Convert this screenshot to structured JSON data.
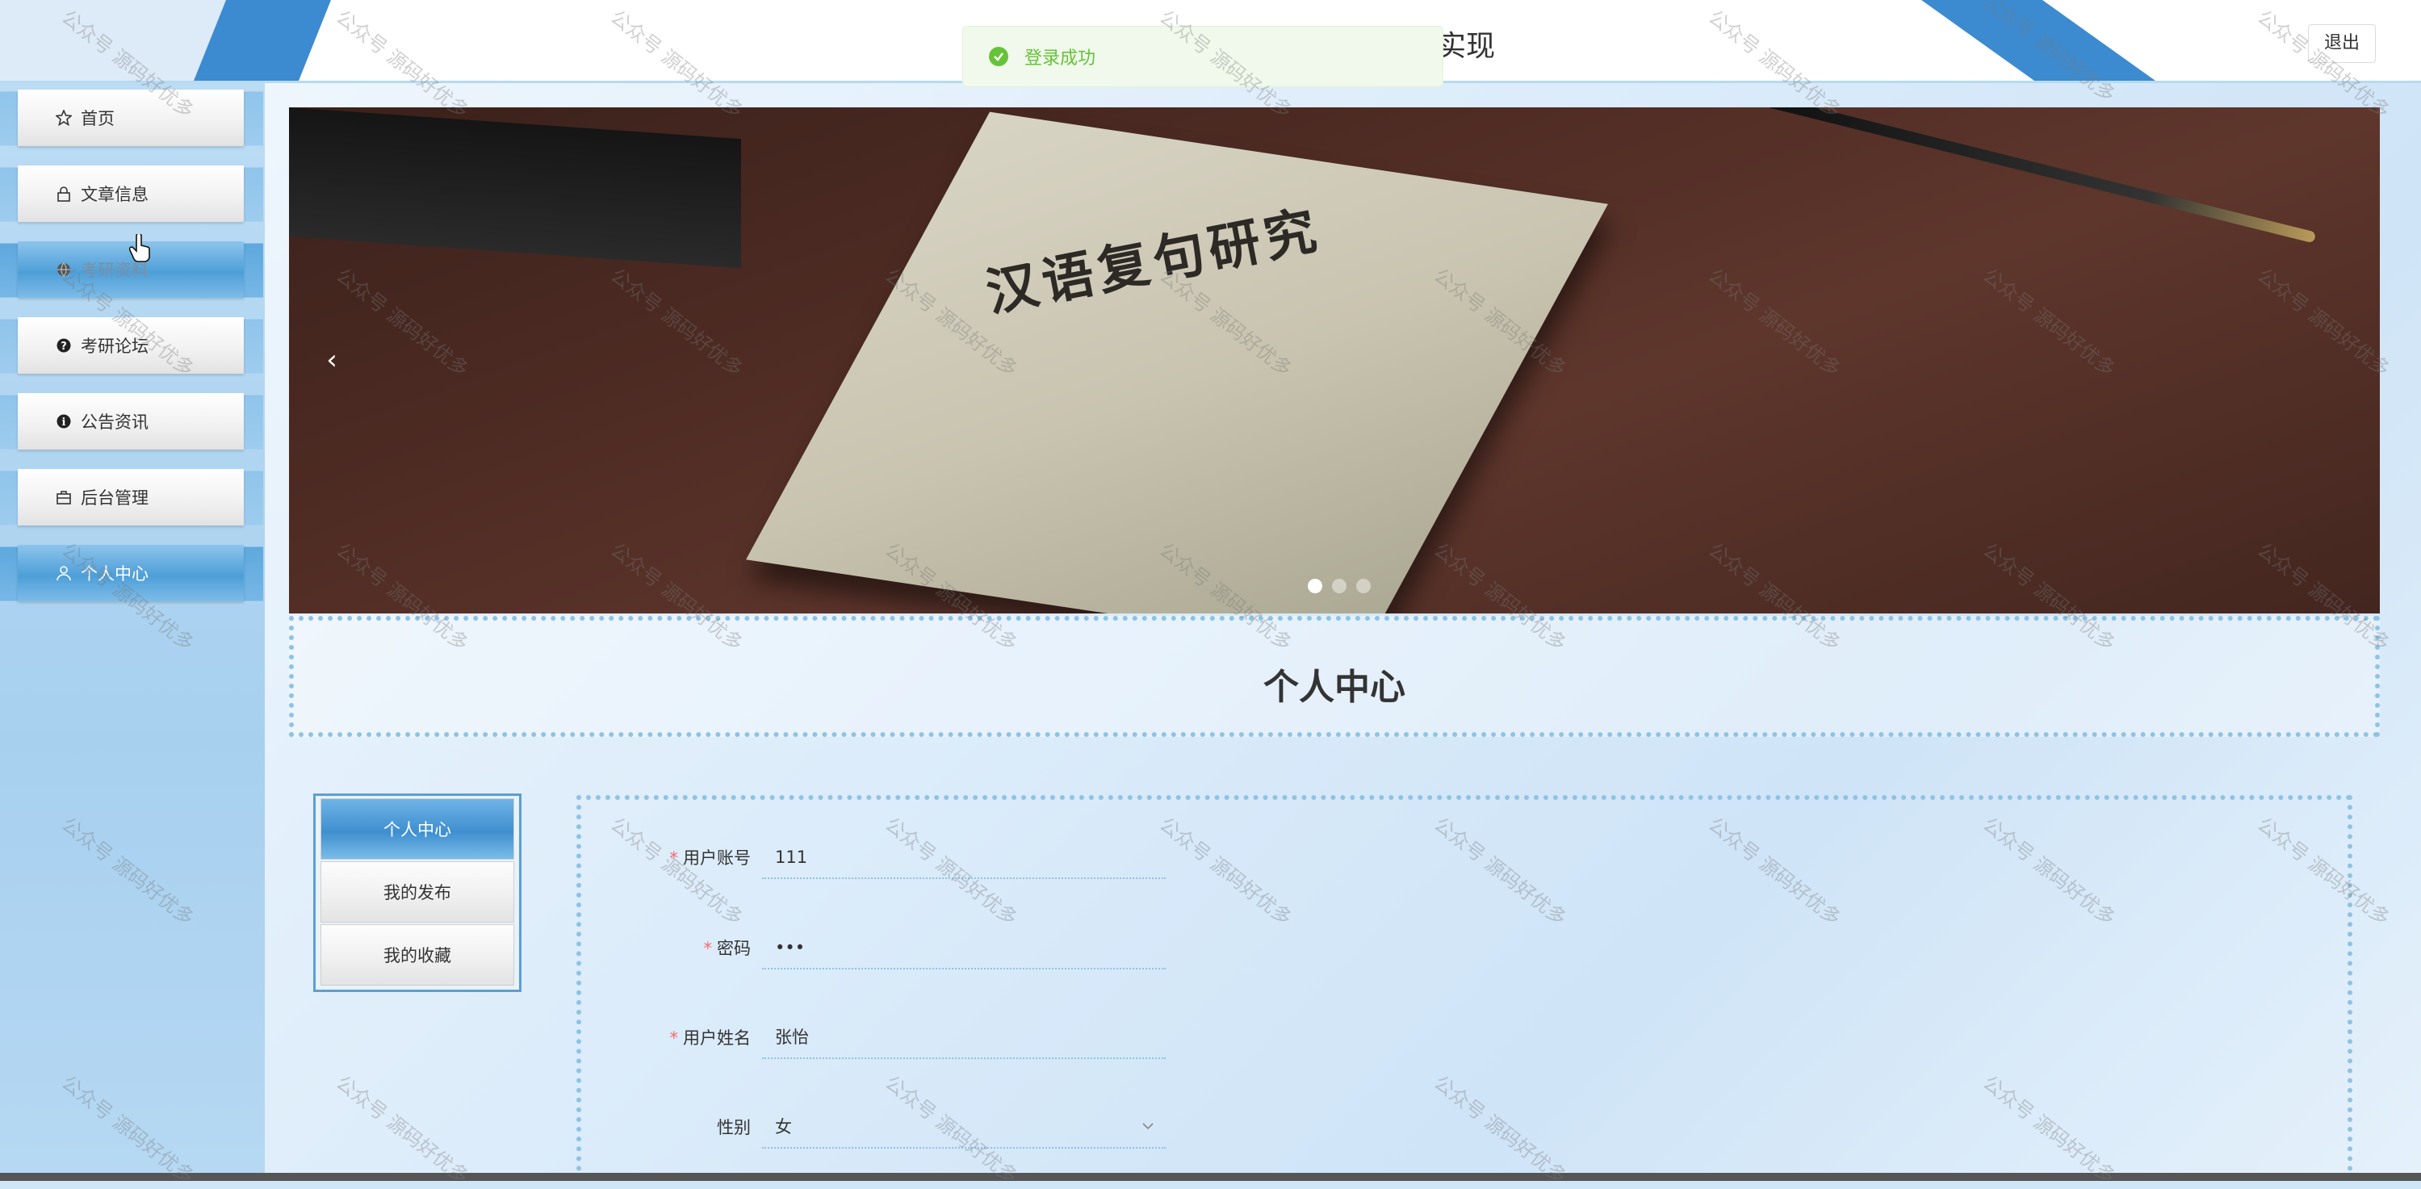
{
  "header": {
    "title": "实现",
    "logout_label": "退出"
  },
  "toast": {
    "message": "登录成功",
    "color": "#67c23a"
  },
  "sidebar": {
    "items": [
      {
        "label": "首页",
        "icon": "star-outline-icon"
      },
      {
        "label": "文章信息",
        "icon": "lock-icon"
      },
      {
        "label": "考研资料",
        "icon": "globe-icon"
      },
      {
        "label": "考研论坛",
        "icon": "question-circle-icon"
      },
      {
        "label": "公告资讯",
        "icon": "info-circle-icon"
      },
      {
        "label": "后台管理",
        "icon": "briefcase-icon"
      },
      {
        "label": "个人中心",
        "icon": "user-icon"
      }
    ],
    "active_index": 6
  },
  "banner": {
    "book_title": "汉语复句研究",
    "dots": 3,
    "active_dot": 0
  },
  "section": {
    "title": "个人中心"
  },
  "tabs": [
    {
      "label": "个人中心",
      "active": true
    },
    {
      "label": "我的发布",
      "active": false
    },
    {
      "label": "我的收藏",
      "active": false
    }
  ],
  "form": {
    "fields": [
      {
        "label": "用户账号",
        "required": true,
        "value": "111"
      },
      {
        "label": "密码",
        "required": true,
        "value": "•••"
      },
      {
        "label": "用户姓名",
        "required": true,
        "value": "张怡"
      },
      {
        "label": "性别",
        "required": false,
        "value": "女",
        "type": "select"
      }
    ]
  },
  "watermark": "公众号 源码好优多",
  "colors": {
    "accent": "#4e9fd8",
    "border_dotted": "#8ec3e4",
    "required": "#f56c6c"
  }
}
